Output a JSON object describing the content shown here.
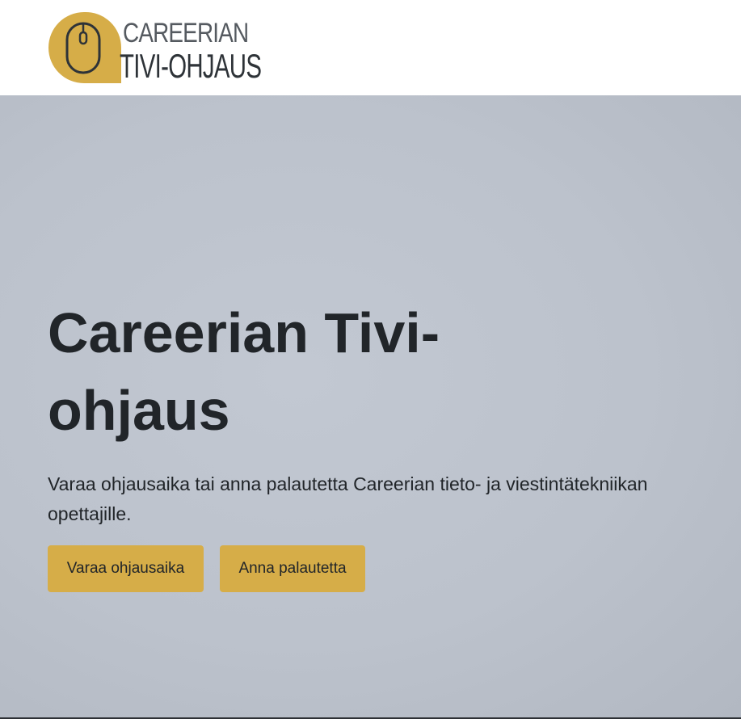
{
  "header": {
    "logo": {
      "line1": "CAREERIAN",
      "line2": "TIVI-OHJAUS",
      "icon": "mouse-icon",
      "badge_color": "#d6ad48"
    }
  },
  "hero": {
    "title": "Careerian Tivi-ohjaus",
    "lead": "Varaa ohjausaika tai anna palautetta Careerian tieto- ja viestintätekniikan opettajille.",
    "buttons": {
      "book_label": "Varaa ohjausaika",
      "feedback_label": "Anna palautetta"
    }
  },
  "colors": {
    "accent": "#d6ad48",
    "hero_background": "#bec4ce",
    "text": "#212529"
  }
}
